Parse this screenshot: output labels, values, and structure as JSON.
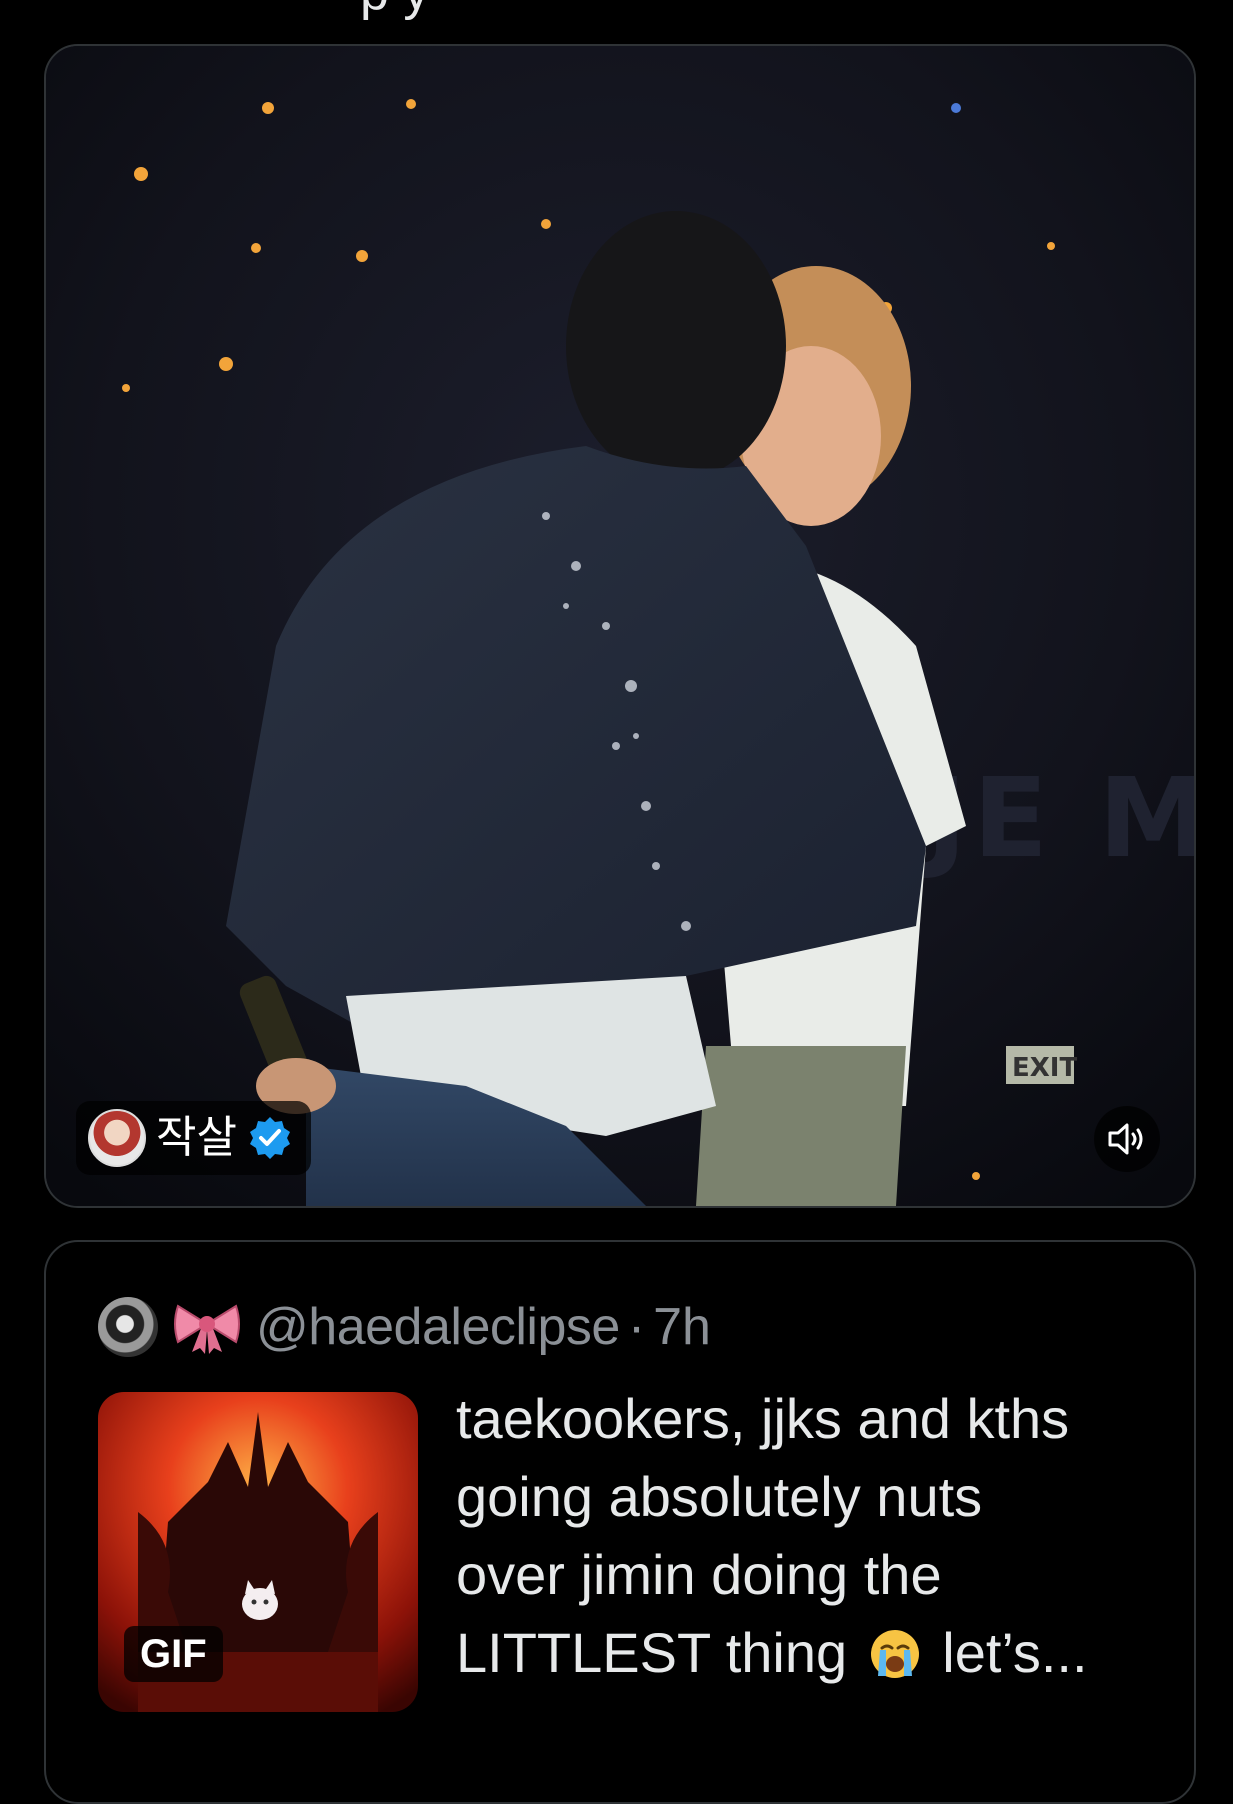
{
  "clipped_previous_text": "p y",
  "video": {
    "author_name": "작살",
    "verified": true,
    "mute_icon": "speaker-icon",
    "backdrop_letters": "JE M",
    "stage_sign": "EXIT"
  },
  "quote": {
    "handle": "@haedaleclipse",
    "separator": "·",
    "time": "7h",
    "bow_icon": "ribbon-bow-emoji",
    "gif_label": "GIF",
    "text_lines": [
      "taekookers, jjks and kths",
      "going absolutely nuts",
      "over jimin doing the",
      "LITTLEST thing"
    ],
    "text_tail": "let’s...",
    "emoji": "loudly-crying-face-emoji"
  },
  "colors": {
    "background": "#000000",
    "border": "#2f3336",
    "muted_text": "#8b9096",
    "verified_blue": "#1d9bf0"
  }
}
